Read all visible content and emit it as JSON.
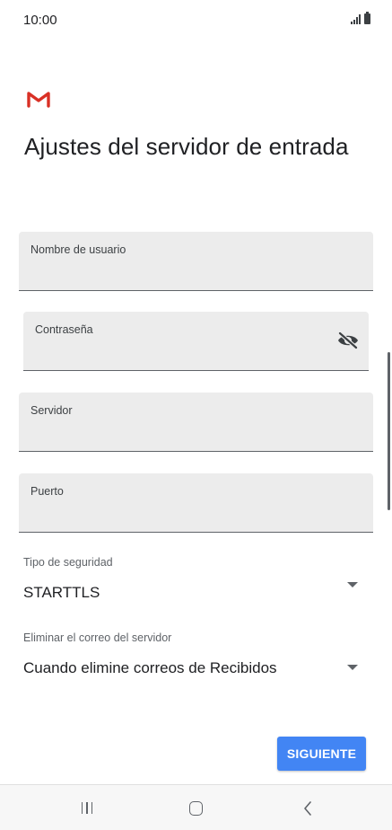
{
  "status_bar": {
    "time": "10:00"
  },
  "header": {
    "logo_icon": "gmail-m-icon",
    "title": "Ajustes del servidor de entrada"
  },
  "form": {
    "username": {
      "label": "Nombre de usuario",
      "value": ""
    },
    "password": {
      "label": "Contraseña",
      "value": "",
      "toggle_icon": "visibility-off-icon"
    },
    "server": {
      "label": "Servidor",
      "value": ""
    },
    "port": {
      "label": "Puerto",
      "value": ""
    },
    "security_type": {
      "label": "Tipo de seguridad",
      "value": "STARTTLS"
    },
    "delete_from_server": {
      "label": "Eliminar el correo del servidor",
      "value": "Cuando elimine correos de Recibidos"
    }
  },
  "actions": {
    "next_label": "SIGUIENTE"
  },
  "nav_bar": {
    "recents_icon": "recents-icon",
    "home_icon": "home-icon",
    "back_icon": "back-icon"
  },
  "colors": {
    "accent": "#4285f4",
    "gmail_red": "#d93025",
    "field_background": "#ececec"
  }
}
